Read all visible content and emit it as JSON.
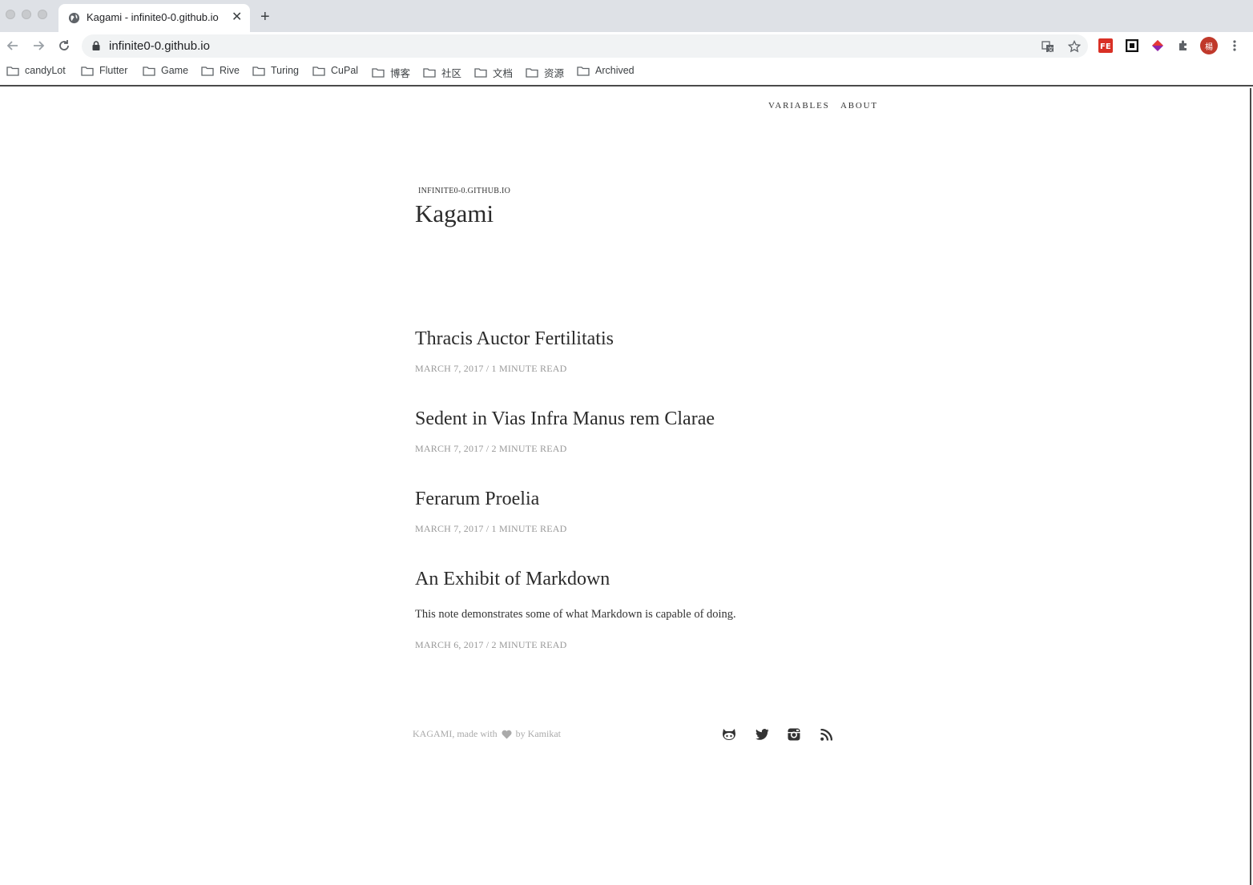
{
  "browser": {
    "tab_title": "Kagami - infinite0-0.github.io",
    "tab_close": "✕",
    "new_tab": "+",
    "url": "infinite0-0.github.io",
    "profile_initial": "楊"
  },
  "bookmarks": [
    "candyLot",
    "Flutter",
    "Game",
    "Rive",
    "Turing",
    "CuPal",
    "博客",
    "社区",
    "文档",
    "资源",
    "Archived"
  ],
  "nav": {
    "variables": "VARIABLES",
    "about": "ABOUT"
  },
  "site": {
    "domain": "INFINITE0-0.GITHUB.IO",
    "title": "Kagami"
  },
  "posts": [
    {
      "title": "Thracis Auctor Fertilitatis",
      "meta": "MARCH 7, 2017 / 1 MINUTE READ",
      "excerpt": ""
    },
    {
      "title": "Sedent in Vias Infra Manus rem Clarae",
      "meta": "MARCH 7, 2017 / 2 MINUTE READ",
      "excerpt": ""
    },
    {
      "title": "Ferarum Proelia",
      "meta": "MARCH 7, 2017 / 1 MINUTE READ",
      "excerpt": ""
    },
    {
      "title": "An Exhibit of Markdown",
      "meta": "MARCH 6, 2017 / 2 MINUTE READ",
      "excerpt": "This note demonstrates some of what Markdown is capable of doing."
    }
  ],
  "footer": {
    "credit_prefix": "KAGAMI, made with",
    "credit_suffix": "by Kamikat"
  },
  "social_icons": [
    "github-icon",
    "twitter-icon",
    "instagram-icon",
    "rss-icon"
  ],
  "colors": {
    "text": "#2b2b2b",
    "meta": "#999999",
    "footer": "#aaaaaa",
    "chrome": "#dee1e6",
    "profile": "#c0392b"
  }
}
